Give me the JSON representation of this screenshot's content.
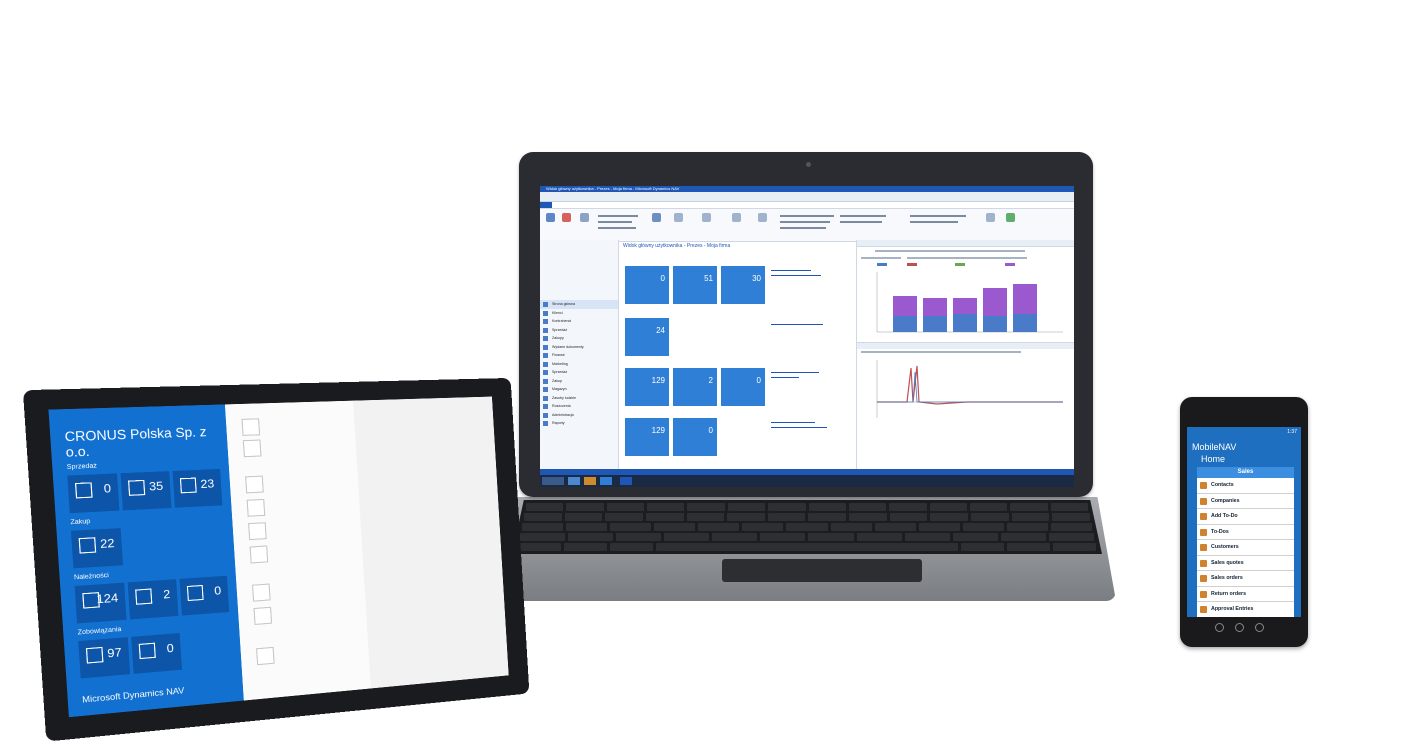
{
  "tablet": {
    "brand": "CRONUS Polska Sp. z o.o.",
    "footer": "Microsoft Dynamics NAV",
    "groups": [
      {
        "label": "Sprzedaż",
        "tiles": [
          {
            "value": "0"
          },
          {
            "value": "35"
          },
          {
            "value": "23"
          }
        ]
      },
      {
        "label": "Zakup",
        "tiles": [
          {
            "value": "22"
          }
        ]
      },
      {
        "label": "Należności",
        "tiles": [
          {
            "value": "124"
          },
          {
            "value": "2"
          },
          {
            "value": "0"
          }
        ]
      },
      {
        "label": "Zobowiązania",
        "tiles": [
          {
            "value": "97"
          },
          {
            "value": "0"
          }
        ]
      }
    ]
  },
  "laptop": {
    "window_title": "Widok główny użytkownika - Prezes - Moja firma - Microsoft Dynamics NAV",
    "page_heading": "Widok główny użytkownika - Prezes - Moja firma",
    "tiles": [
      {
        "value": "0"
      },
      {
        "value": "51"
      },
      {
        "value": "30"
      },
      {
        "value": "24"
      },
      {
        "value": "129"
      },
      {
        "value": "2"
      },
      {
        "value": "0"
      },
      {
        "value": "129"
      },
      {
        "value": "0"
      }
    ],
    "nav_items": [
      "Strona główna",
      "Klienci",
      "Kontrahenci",
      "Sprzedaż",
      "Zakupy",
      "Wydane dokumenty",
      "Finanse",
      "Marketing",
      "Sprzedaż",
      "Zakup",
      "Magazyn",
      "Zasoby ludzkie",
      "Roszczenia",
      "Administracja",
      "Raporty"
    ]
  },
  "phone": {
    "status_time": "1:37",
    "app_name": "MobileNAV",
    "home": "Home",
    "section": "Sales",
    "items": [
      {
        "label": "Contacts"
      },
      {
        "label": "Companies"
      },
      {
        "label": "Add To-Do"
      },
      {
        "label": "To-Dos"
      },
      {
        "label": "Customers"
      },
      {
        "label": "Sales quotes"
      },
      {
        "label": "Sales orders"
      },
      {
        "label": "Return orders"
      },
      {
        "label": "Approval Entries"
      }
    ]
  },
  "colors": {
    "nav_blue": "#1e57b6",
    "tile_blue": "#2f7fd6",
    "tablet_blue": "#1270d0",
    "phone_blue": "#1e6fbf",
    "accent_orange": "#d0832e"
  }
}
